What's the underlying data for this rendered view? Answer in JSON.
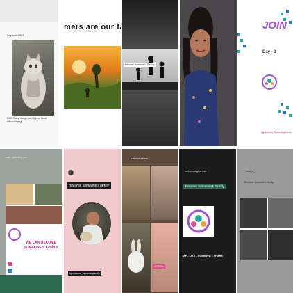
{
  "row1": {
    "t1": {
      "username": "hey.kutti.2003",
      "caption": "2003 Some things just fill your heart without trying"
    },
    "t2": {
      "headline": "mers are our fa"
    },
    "t3": {
      "badge_text": "Become Someone's Family"
    },
    "t4": {},
    "t5": {
      "headline": "JOIN",
      "day": "Day - 3",
      "hashtags": "#guptaans_becomingfamily"
    }
  },
  "row2": {
    "t6": {
      "username": "mari_ballanika_sku",
      "footer": "WE CAN BECOME SOMEONE'S FAMILY"
    },
    "t7": {
      "banner": "Become someone's family",
      "tag": "#guptaans_becomingfamily"
    },
    "t8": {
      "username": "suhinesandhana",
      "tag": "#GBIZzz"
    },
    "t9": {
      "username": "suchanapalghar.com",
      "title": "Become Someone's Family",
      "cta": "TAP - LIKE - COMMENT - SHARE"
    },
    "t10": {
      "username": "mari_in_",
      "subtitle": "Become someone's family"
    }
  },
  "colors": {
    "accent_purple": "#a34fd1",
    "teal": "#2aa7a0",
    "green_bar": "#2f6b54"
  }
}
